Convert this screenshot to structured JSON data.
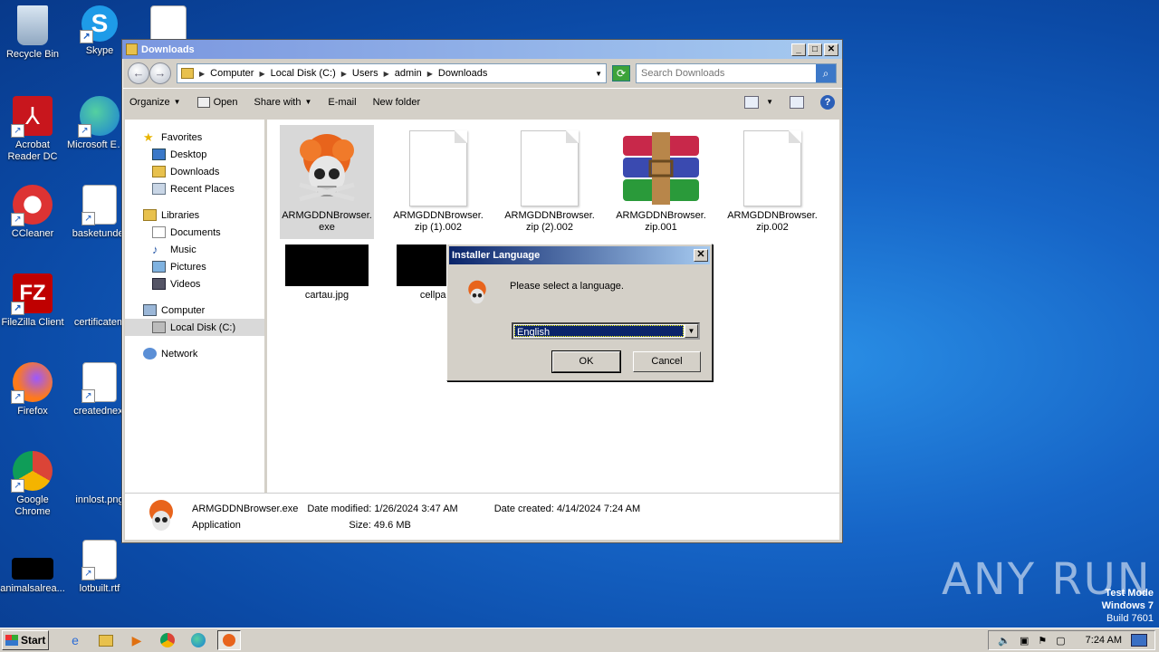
{
  "desktop": {
    "icons": [
      {
        "label": "Recycle Bin"
      },
      {
        "label": "Skype"
      },
      {
        "label": "Acrobat Reader DC"
      },
      {
        "label": "Microsoft Edge"
      },
      {
        "label": "CCleaner"
      },
      {
        "label": "basketunder"
      },
      {
        "label": "FileZilla Client"
      },
      {
        "label": "certificatem"
      },
      {
        "label": "Firefox"
      },
      {
        "label": "creatednext"
      },
      {
        "label": "Google Chrome"
      },
      {
        "label": "innlost.png"
      },
      {
        "label": "animalsalrea..."
      },
      {
        "label": "lotbuilt.rtf"
      }
    ]
  },
  "explorer": {
    "title": "Downloads",
    "address": {
      "crumbs": [
        "Computer",
        "Local Disk (C:)",
        "Users",
        "admin",
        "Downloads"
      ]
    },
    "search_placeholder": "Search Downloads",
    "toolbar": {
      "organize": "Organize",
      "open": "Open",
      "share_with": "Share with",
      "email": "E-mail",
      "new_folder": "New folder"
    },
    "nav": {
      "favorites": "Favorites",
      "desktop": "Desktop",
      "downloads": "Downloads",
      "recent_places": "Recent Places",
      "libraries": "Libraries",
      "documents": "Documents",
      "music": "Music",
      "pictures": "Pictures",
      "videos": "Videos",
      "computer": "Computer",
      "local_disk": "Local Disk (C:)",
      "network": "Network"
    },
    "files": [
      {
        "name": "ARMGDDNBrowser.exe",
        "line1": "ARMGDDNBrowser.",
        "line2": "exe"
      },
      {
        "name": "ARMGDDNBrowser.zip (1).002",
        "line1": "ARMGDDNBrowser.",
        "line2": "zip (1).002"
      },
      {
        "name": "ARMGDDNBrowser.zip (2).002",
        "line1": "ARMGDDNBrowser.",
        "line2": "zip (2).002"
      },
      {
        "name": "ARMGDDNBrowser.zip.001",
        "line1": "ARMGDDNBrowser.",
        "line2": "zip.001"
      },
      {
        "name": "ARMGDDNBrowser.zip.002",
        "line1": "ARMGDDNBrowser.",
        "line2": "zip.002"
      },
      {
        "name": "cartau.jpg",
        "line1": "cartau.jpg",
        "line2": ""
      },
      {
        "name": "cellparis",
        "line1": "cellparis",
        "line2": ""
      }
    ],
    "details": {
      "filename": "ARMGDDNBrowser.exe",
      "type": "Application",
      "modified_label": "Date modified:",
      "modified_value": "1/26/2024 3:47 AM",
      "created_label": "Date created:",
      "created_value": "4/14/2024 7:24 AM",
      "size_label": "Size:",
      "size_value": "49.6 MB"
    }
  },
  "dialog": {
    "title": "Installer Language",
    "message": "Please select a language.",
    "selected_language": "English",
    "ok_label": "OK",
    "cancel_label": "Cancel"
  },
  "taskbar": {
    "start_label": "Start",
    "clock": "7:24 AM"
  },
  "watermark": {
    "text": "ANY RUN"
  },
  "system": {
    "line1": "Test Mode",
    "line2": "Windows 7",
    "line3": "Build 7601"
  }
}
